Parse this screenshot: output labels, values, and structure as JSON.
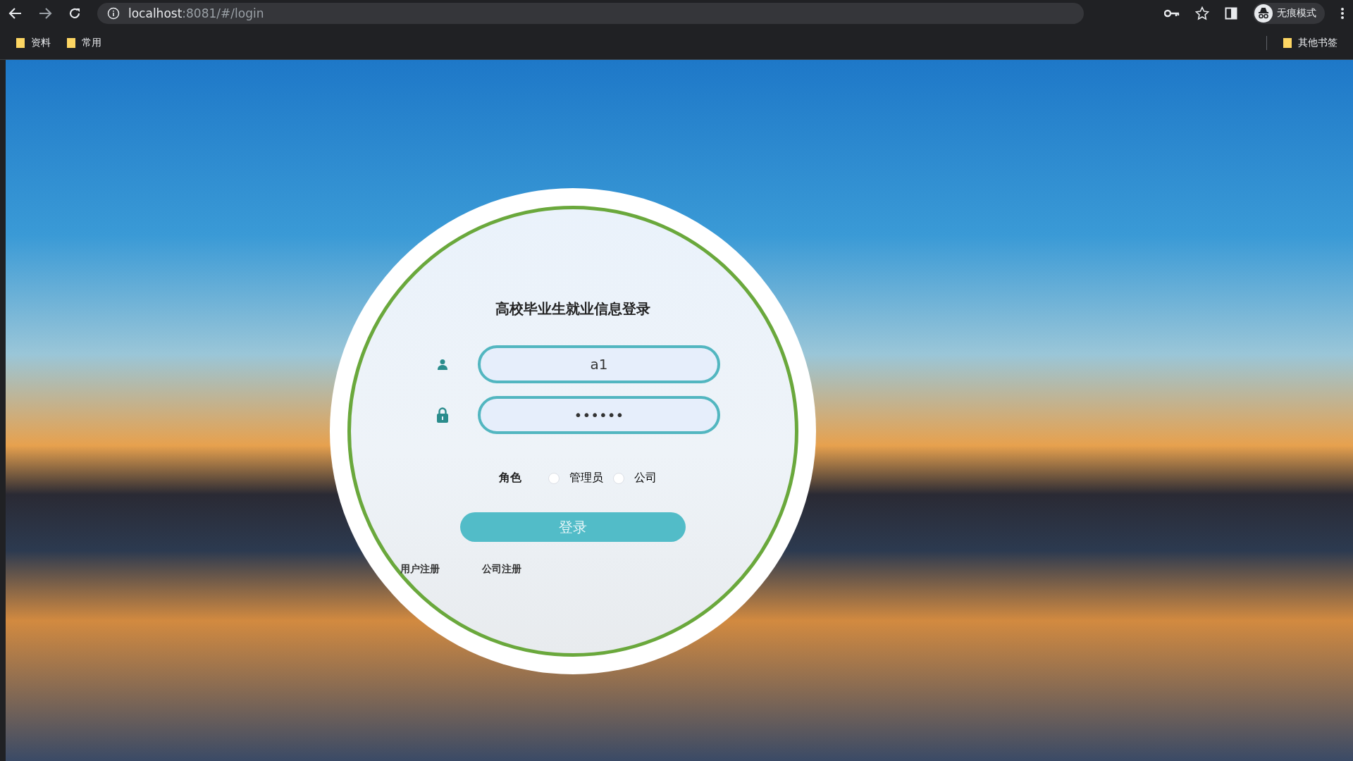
{
  "browser": {
    "url_host": "localhost",
    "url_rest": ":8081/#/login",
    "profile_label": "无痕模式",
    "bookmarks": [
      "资料",
      "常用"
    ],
    "other_bookmarks": "其他书签"
  },
  "login": {
    "title": "高校毕业生就业信息登录",
    "username": {
      "value": "a1"
    },
    "password": {
      "value": "••••••"
    },
    "role_label": "角色",
    "roles": [
      {
        "label": "管理员",
        "selected": false
      },
      {
        "label": "公司",
        "selected": false
      }
    ],
    "submit": "登录",
    "links": [
      "用户注册",
      "公司注册"
    ]
  }
}
